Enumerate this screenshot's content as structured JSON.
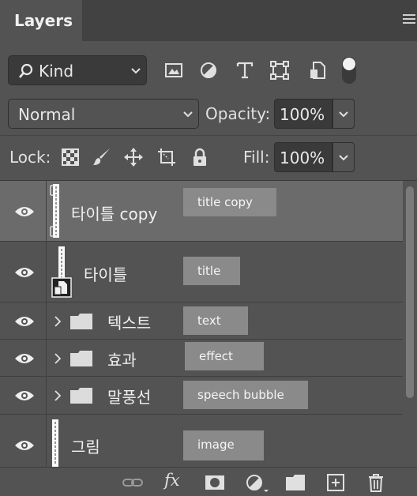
{
  "panel": {
    "tab_title": "Layers",
    "menu_icon": "panel-menu-icon"
  },
  "filter": {
    "kind_label": "Kind",
    "icons": [
      "image-filter-icon",
      "adjustment-filter-icon",
      "type-filter-icon",
      "shape-filter-icon",
      "smart-object-filter-icon",
      "filter-toggle-icon"
    ]
  },
  "blend": {
    "mode": "Normal",
    "opacity_label": "Opacity:",
    "opacity_value": "100%"
  },
  "lock": {
    "label": "Lock:",
    "icons": [
      "lock-transparent-pixels-icon",
      "lock-image-pixels-icon",
      "lock-position-icon",
      "lock-artboard-icon",
      "lock-all-icon"
    ],
    "fill_label": "Fill:",
    "fill_value": "100%"
  },
  "layers": [
    {
      "name": "타이틀 copy",
      "note": "title copy",
      "type": "layer",
      "selected": true
    },
    {
      "name": "타이틀",
      "note": "title",
      "type": "smart-object",
      "selected": false
    },
    {
      "name": "텍스트",
      "note": "text",
      "type": "group",
      "selected": false
    },
    {
      "name": "효과",
      "note": "effect",
      "type": "group",
      "selected": false
    },
    {
      "name": "말풍선",
      "note": "speech bubble",
      "type": "group",
      "selected": false
    },
    {
      "name": "그림",
      "note": "image",
      "type": "layer",
      "selected": false
    }
  ],
  "toolbar": {
    "icons": [
      "link-layers-icon",
      "fx-icon",
      "layer-mask-icon",
      "adjustment-layer-icon",
      "new-group-icon",
      "new-layer-icon",
      "delete-icon"
    ],
    "fx_label": "fx"
  },
  "colors": {
    "panel_bg": "#535353",
    "selected_row": "#6b6b6b",
    "note_bg": "#8a8a8a"
  }
}
